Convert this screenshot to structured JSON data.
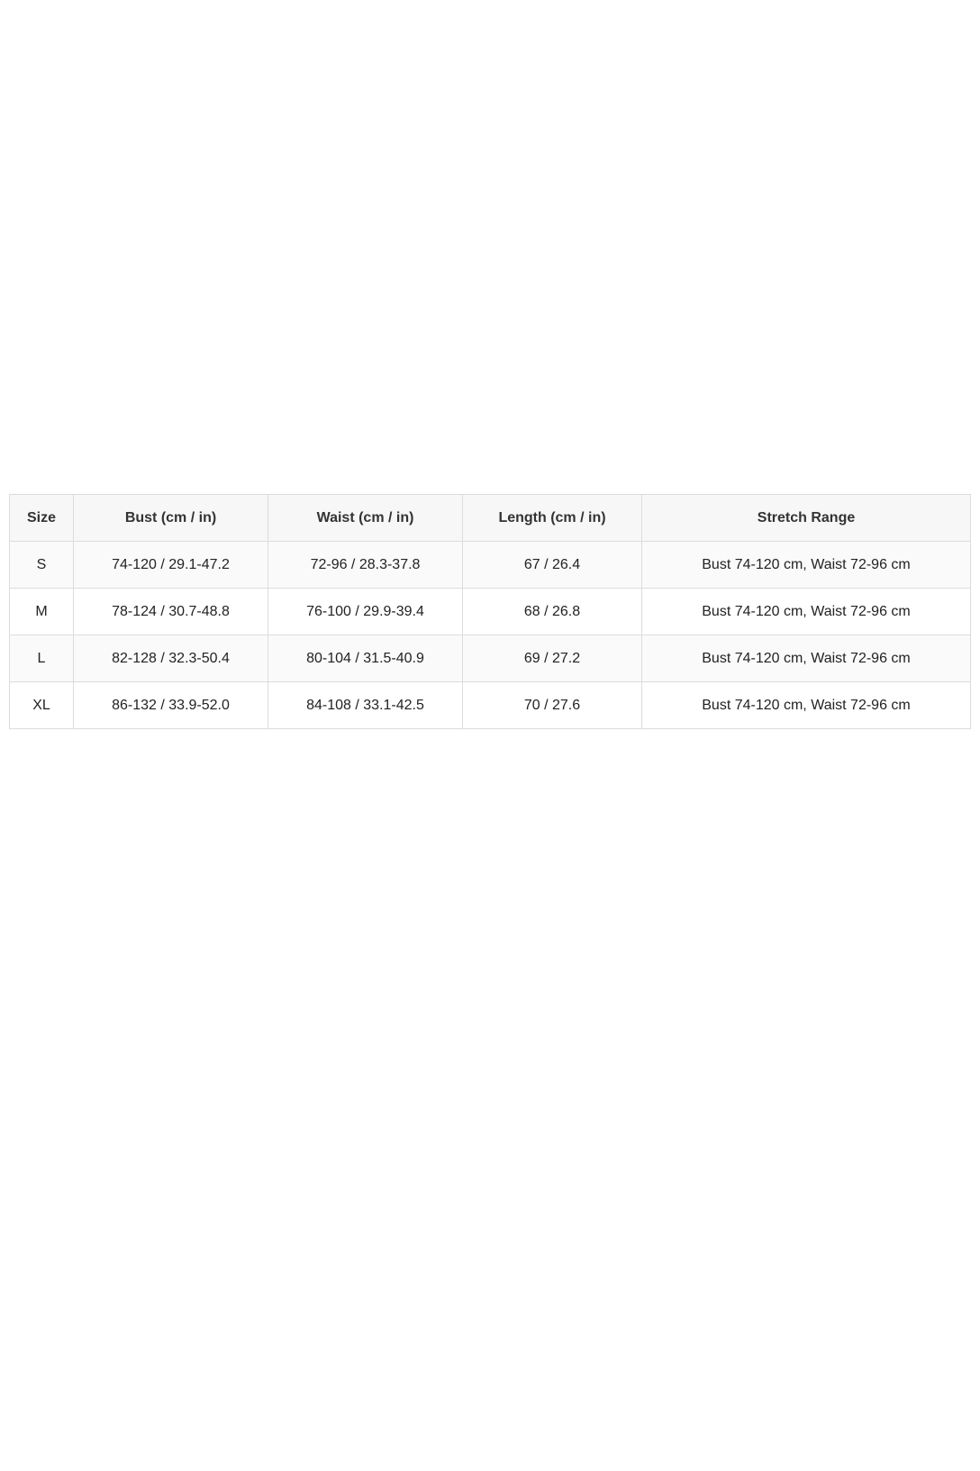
{
  "table": {
    "headers": [
      "Size",
      "Bust (cm / in)",
      "Waist (cm / in)",
      "Length (cm / in)",
      "Stretch Range"
    ],
    "rows": [
      [
        "S",
        "74-120 / 29.1-47.2",
        "72-96 / 28.3-37.8",
        "67 / 26.4",
        "Bust 74-120 cm, Waist 72-96 cm"
      ],
      [
        "M",
        "78-124 / 30.7-48.8",
        "76-100 / 29.9-39.4",
        "68 / 26.8",
        "Bust 74-120 cm, Waist 72-96 cm"
      ],
      [
        "L",
        "82-128 / 32.3-50.4",
        "80-104 / 31.5-40.9",
        "69 / 27.2",
        "Bust 74-120 cm, Waist 72-96 cm"
      ],
      [
        "XL",
        "86-132 / 33.9-52.0",
        "84-108 / 33.1-42.5",
        "70 / 27.6",
        "Bust 74-120 cm, Waist 72-96 cm"
      ]
    ]
  },
  "colors": {
    "header_background": "#f7f7f8",
    "border": "#dcdcdc",
    "text": "#222222"
  }
}
